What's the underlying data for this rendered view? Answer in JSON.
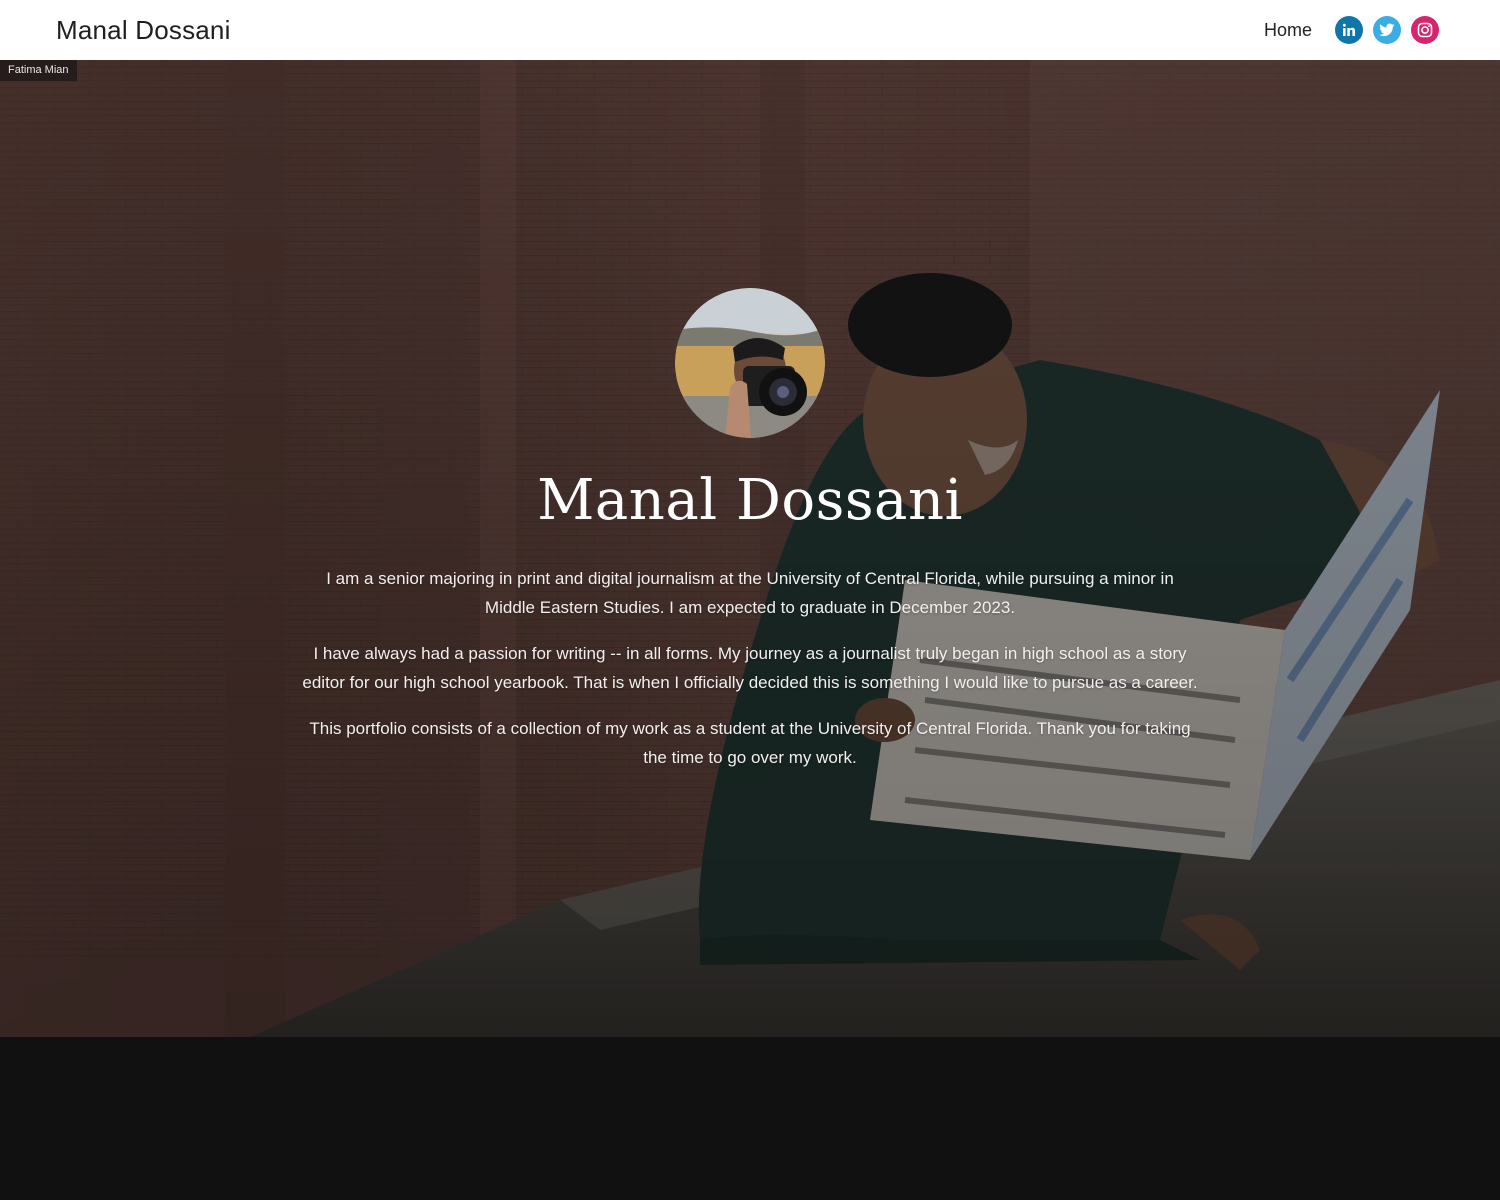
{
  "header": {
    "site_title": "Manal Dossani",
    "nav": {
      "home_label": "Home"
    },
    "social": [
      {
        "name": "linkedin",
        "icon": "linkedin-icon",
        "color": "#0e76a8"
      },
      {
        "name": "twitter",
        "icon": "twitter-icon",
        "color": "#3aaee4"
      },
      {
        "name": "instagram",
        "icon": "instagram-icon",
        "color": "#d6246e"
      }
    ]
  },
  "hero": {
    "photo_credit": "Fatima Mian",
    "name": "Manal Dossani",
    "bio": [
      "I am a senior majoring in print and digital journalism at the University of Central Florida, while pursuing a minor in Middle Eastern Studies. I am expected to graduate in December 2023.",
      "I have always had a passion for writing -- in all forms. My journey as a journalist truly began in high school as a story editor for our high school yearbook. That is when I officially decided this is something I would like to pursue as a career.",
      "This portfolio consists of a collection of my work as a student at the University of Central Florida. Thank you for taking the time to go over my work."
    ]
  },
  "colors": {
    "header_bg": "#ffffff",
    "footer_bg": "#111111",
    "hero_text": "#ffffff"
  }
}
